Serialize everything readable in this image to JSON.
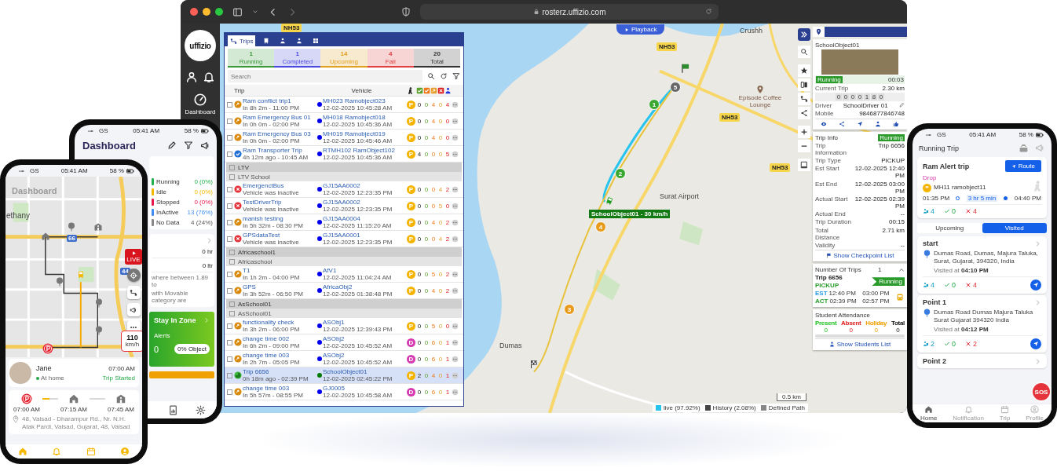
{
  "browser": {
    "url": "rosterz.uffizio.com"
  },
  "app_sidebar": {
    "logo": "uffizio",
    "nav_label": "Dashboard"
  },
  "trips_panel": {
    "tabs": [
      {
        "label": "Trips",
        "kind": "route",
        "selected": true
      },
      {
        "kind": "bus",
        "selected": false
      },
      {
        "kind": "person",
        "selected": false
      },
      {
        "kind": "driver",
        "selected": false
      },
      {
        "kind": "grid",
        "selected": false
      }
    ],
    "summary": [
      {
        "count": "1",
        "label": "Running",
        "color": "#3a9a3a"
      },
      {
        "count": "1",
        "label": "Completed",
        "color": "#4a4ae0"
      },
      {
        "count": "14",
        "label": "Upcoming",
        "color": "#e0a020"
      },
      {
        "count": "4",
        "label": "Fail",
        "color": "#e04040"
      },
      {
        "count": "20",
        "label": "Total",
        "color": "#333333"
      }
    ],
    "search": {
      "placeholder": "Search"
    },
    "columns": [
      {
        "label": "Trip"
      },
      {
        "label": "Vehicle"
      },
      {
        "kind": "walk",
        "color": "#222222"
      },
      {
        "kind": "check",
        "color": "#5aa02c"
      },
      {
        "kind": "check",
        "color": "#f07a1a"
      },
      {
        "kind": "arrow",
        "color": "#e8a030"
      },
      {
        "kind": "cross",
        "color": "#e02020"
      },
      {
        "kind": "person",
        "color": "#2233dd"
      }
    ],
    "rows": [
      {
        "kind": "trip",
        "status": {
          "kind": "upcoming"
        },
        "name": "Ram conflict trip1",
        "detail": "In 8h 2m - 11:00 PM",
        "vehicle": "MH023 Ramobject023",
        "time": "12-02-2025 10:45:28 AM",
        "color": "#0000ee",
        "badge": {
          "text": "P",
          "color": "#f5b400"
        },
        "counts": [
          "0",
          "0",
          "4",
          "0",
          "4"
        ],
        "selected": false
      },
      {
        "kind": "trip",
        "status": {
          "kind": "upcoming"
        },
        "name": "Ram Emergency Bus 01",
        "detail": "In 0h 0m - 02:00 PM",
        "vehicle": "MH018 Ramobject018",
        "time": "12-02-2025 10:45:36 AM",
        "color": "#0000ee",
        "badge": {
          "text": "P",
          "color": "#f5b400"
        },
        "counts": [
          "0",
          "0",
          "4",
          "0",
          "0"
        ],
        "selected": false
      },
      {
        "kind": "trip",
        "status": {
          "kind": "upcoming"
        },
        "name": "Ram Emergency Bus 03",
        "detail": "In 0h 0m - 02:00 PM",
        "vehicle": "MH019 Ramobject019",
        "time": "12-02-2025 10:45:46 AM",
        "color": "#0000ee",
        "badge": {
          "text": "P",
          "color": "#f5b400"
        },
        "counts": [
          "0",
          "0",
          "4",
          "0",
          "0"
        ],
        "selected": false
      },
      {
        "kind": "trip",
        "status": {
          "kind": "completed"
        },
        "name": "Ram Transporter Trip",
        "detail": "4h 12m ago - 10:45 AM",
        "vehicle": "RTMH102 RamObject102",
        "time": "12-02-2025 10:45:36 AM",
        "color": "#0000ee",
        "badge": {
          "text": "P",
          "color": "#f5b400"
        },
        "counts": [
          "4",
          "0",
          "0",
          "0",
          "5"
        ],
        "selected": false
      },
      {
        "kind": "group",
        "label": "LTV",
        "checked": false
      },
      {
        "kind": "subgroup",
        "label": "LTV School",
        "checked": false
      },
      {
        "kind": "trip",
        "status": {
          "kind": "fail"
        },
        "name": "EmergenctBus",
        "detail": "Vehicle was inactive",
        "vehicle": "GJ15AA0002",
        "time": "12-02-2025 12:23:35 PM",
        "color": "#0000ee",
        "badge": {
          "text": "P",
          "color": "#f5b400"
        },
        "counts": [
          "0",
          "0",
          "0",
          "4",
          "2"
        ],
        "selected": false
      },
      {
        "kind": "trip",
        "status": {
          "kind": "fail"
        },
        "name": "TestDriverTrip",
        "detail": "Vehicle was inactive",
        "vehicle": "GJ15AA0002",
        "time": "12-02-2025 12:23:35 PM",
        "color": "#0000ee",
        "badge": {
          "text": "P",
          "color": "#f5b400"
        },
        "counts": [
          "0",
          "0",
          "0",
          "5",
          "0"
        ],
        "selected": false
      },
      {
        "kind": "trip",
        "status": {
          "kind": "upcoming"
        },
        "name": "manish testing",
        "detail": "In 5h 32m - 08:30 PM",
        "vehicle": "GJ15AA0004",
        "time": "12-02-2025 11:15:20 AM",
        "color": "#0000ee",
        "badge": {
          "text": "P",
          "color": "#f5b400"
        },
        "counts": [
          "0",
          "0",
          "4",
          "0",
          "2"
        ],
        "selected": false
      },
      {
        "kind": "trip",
        "status": {
          "kind": "fail"
        },
        "name": "GPSdataTest",
        "detail": "Vehicle was inactive",
        "vehicle": "GJ15AA0001",
        "time": "12-02-2025 12:23:35 PM",
        "color": "#0000ee",
        "badge": {
          "text": "P",
          "color": "#f5b400"
        },
        "counts": [
          "0",
          "0",
          "0",
          "4",
          "2"
        ],
        "selected": false
      },
      {
        "kind": "group",
        "label": "Africaschool1",
        "checked": false
      },
      {
        "kind": "subgroup",
        "label": "Africaschool",
        "checked": false
      },
      {
        "kind": "trip",
        "status": {
          "kind": "upcoming"
        },
        "name": "T1",
        "detail": "In 1h 2m - 04:00 PM",
        "vehicle": "AfV1",
        "time": "12-02-2025 11:04:24 AM",
        "color": "#0000ee",
        "badge": {
          "text": "P",
          "color": "#f5b400"
        },
        "counts": [
          "0",
          "0",
          "5",
          "0",
          "2"
        ],
        "selected": false
      },
      {
        "kind": "trip",
        "status": {
          "kind": "upcoming"
        },
        "name": "GPS",
        "detail": "In 3h 52m - 06:50 PM",
        "vehicle": "AfricaObj2",
        "time": "12-02-2025 01:38:48 PM",
        "color": "#0000ee",
        "badge": {
          "text": "P",
          "color": "#f5b400"
        },
        "counts": [
          "0",
          "0",
          "4",
          "0",
          "2"
        ],
        "selected": false
      },
      {
        "kind": "group",
        "label": "AsSchool01",
        "checked": false
      },
      {
        "kind": "subgroup",
        "label": "AsSchool01",
        "checked": false
      },
      {
        "kind": "trip",
        "status": {
          "kind": "upcoming"
        },
        "name": "functionality check",
        "detail": "In 3h 2m - 06:00 PM",
        "vehicle": "ASObj1",
        "time": "12-02-2025 12:39:43 PM",
        "color": "#0000ee",
        "badge": {
          "text": "P",
          "color": "#f5b400"
        },
        "counts": [
          "0",
          "0",
          "5",
          "0",
          "0"
        ],
        "selected": false
      },
      {
        "kind": "trip",
        "status": {
          "kind": "upcoming"
        },
        "name": "change time 002",
        "detail": "In 6h 2m - 09:00 PM",
        "vehicle": "ASObj2",
        "time": "12-02-2025 10:45:52 AM",
        "color": "#0000ee",
        "badge": {
          "text": "D",
          "color": "#d63ab0"
        },
        "counts": [
          "0",
          "0",
          "6",
          "0",
          "1"
        ],
        "selected": false
      },
      {
        "kind": "trip",
        "status": {
          "kind": "upcoming"
        },
        "name": "change time 003",
        "detail": "In 2h 7m - 05:05 PM",
        "vehicle": "ASObj2",
        "time": "12-02-2025 10:45:52 AM",
        "color": "#0000ee",
        "badge": {
          "text": "D",
          "color": "#d63ab0"
        },
        "counts": [
          "0",
          "0",
          "6",
          "0",
          "1"
        ],
        "selected": false
      },
      {
        "kind": "trip",
        "status": {
          "kind": "running"
        },
        "name": "Trip 6656",
        "detail": "0h 18m ago - 02:39 PM",
        "vehicle": "SchoolObject01",
        "time": "12-02-2025 02:45:22 PM",
        "color": "#007a00",
        "badge": {
          "text": "P",
          "color": "#f5b400"
        },
        "counts": [
          "2",
          "0",
          "4",
          "0",
          "1"
        ],
        "selected": true
      },
      {
        "kind": "trip",
        "status": {
          "kind": "upcoming"
        },
        "name": "change time 003",
        "detail": "In 5h 57m - 08:55 PM",
        "vehicle": "GJ0005",
        "time": "12-02-2025 10:45:58 AM",
        "color": "#0000ee",
        "badge": {
          "text": "D",
          "color": "#d63ab0"
        },
        "counts": [
          "0",
          "0",
          "6",
          "0",
          "1"
        ],
        "selected": false
      }
    ]
  },
  "map": {
    "playback": "Playback",
    "labels": [
      {
        "text": "NH53",
        "kind": "road"
      },
      {
        "text": "NH53",
        "kind": "road"
      },
      {
        "text": "NH53",
        "kind": "road"
      },
      {
        "text": "NH53",
        "kind": "road"
      },
      {
        "text": "Crushh",
        "kind": "place"
      },
      {
        "text": "Episode Coffee Lounge",
        "kind": "poi"
      },
      {
        "text": "Surat Airport",
        "kind": "place"
      },
      {
        "text": "Dumas",
        "kind": "place"
      }
    ],
    "markers": [
      {
        "text": "1",
        "color": "#3aa830"
      },
      {
        "text": "2",
        "color": "#3aa830"
      },
      {
        "text": "3",
        "color": "#e89a1a"
      },
      {
        "text": "4",
        "color": "#e89a1a"
      },
      {
        "text": "5",
        "color": "#666666"
      }
    ],
    "vehicle_label": "SchoolObject01 - 30 km/h",
    "legend": [
      {
        "label": "live (97.92%)",
        "color": "#29c4ee"
      },
      {
        "label": "History (2.08%)",
        "color": "#444444"
      },
      {
        "label": "Defined Path",
        "color": "#888888"
      }
    ],
    "scale": "0.5 km"
  },
  "object_panel": {
    "name": "SchoolObject01",
    "status": "Running",
    "duration": "00:03",
    "current_trip": {
      "label": "Current Trip",
      "value": "2.30 km"
    },
    "odometer": [
      "0",
      "0",
      "0",
      "0",
      "1",
      "8",
      "0"
    ],
    "fields": [
      {
        "label": "Driver",
        "value": "SchoolDriver 01"
      },
      {
        "label": "Mobile",
        "value": "9846877846748"
      }
    ]
  },
  "trip_info": {
    "title": "Trip Info",
    "status": "Running",
    "rows": [
      {
        "label": "Trip Information",
        "value": "Trip 6656"
      },
      {
        "label": "Trip Type",
        "value": "PICKUP"
      },
      {
        "label": "Est Start",
        "value": "12-02-2025 12:40 PM"
      },
      {
        "label": "Est End",
        "value": "12-02-2025 03:00 PM"
      },
      {
        "label": "Actual Start",
        "value": "12-02-2025 02:39 PM"
      },
      {
        "label": "Actual End",
        "value": "--"
      },
      {
        "label": "Trip Duration",
        "value": "00:15"
      },
      {
        "label": "Total Distance",
        "value": "2.71 km"
      },
      {
        "label": "Validity",
        "value": "--"
      }
    ],
    "link": "Show Checkpoint List"
  },
  "number_of_trips": {
    "title": "Number Of Trips",
    "count": "1",
    "trip": "Trip 6656",
    "type": "PICKUP",
    "status": "Running",
    "times": [
      {
        "label": "EST",
        "start": "12:40 PM",
        "end": "03:00 PM",
        "color": "#2a9de0"
      },
      {
        "label": "ACT",
        "start": "02:39 PM",
        "end": "02:57 PM",
        "color": "#2aa02a"
      }
    ]
  },
  "attendance": {
    "title": "Student Attendance",
    "items": [
      {
        "label": "Present",
        "value": "0",
        "color": "#22c422"
      },
      {
        "label": "Absent",
        "value": "0",
        "color": "#e02020"
      },
      {
        "label": "Holiday",
        "value": "0",
        "color": "#f0a000"
      },
      {
        "label": "Total",
        "value": "0",
        "color": "#111111"
      }
    ],
    "link": "Show Students List"
  },
  "back_phone": {
    "status": {
      "carrier": "GS",
      "time": "05:41 AM",
      "battery": "58 %"
    },
    "title": "Dashboard",
    "legend": [
      {
        "label": "Running",
        "value": "0 (0%)",
        "color": "#22b14c"
      },
      {
        "label": "Idle",
        "value": "0 (0%)",
        "color": "#f5b800"
      },
      {
        "label": "Stopped",
        "value": "0 (0%)",
        "color": "#e8194a"
      },
      {
        "label": "InActive",
        "value": "13 (76%)",
        "color": "#3d8ef0"
      },
      {
        "label": "No Data",
        "value": "4 (24%)",
        "color": "#888888"
      }
    ],
    "stats": [
      "0 hr",
      "0 ltr"
    ],
    "note_lines": [
      "where between 1.89 to",
      "with Movable category are"
    ],
    "zone": {
      "title": "Stay In Zone",
      "alerts_label": "Alerts",
      "alerts": "0",
      "object_badge": "0% Object"
    }
  },
  "front_phone": {
    "status": {
      "carrier": "GS",
      "time": "05:41 AM",
      "battery": "58 %"
    },
    "map_labels": [
      {
        "text": "Dashboard",
        "kind": "ghost"
      },
      {
        "text": "ethany",
        "kind": "place"
      },
      {
        "text": "66",
        "kind": "shield"
      },
      {
        "text": "44",
        "kind": "shield"
      }
    ],
    "live_button": "LIVE",
    "speed": {
      "value": "110",
      "unit": "km/h"
    },
    "rider": {
      "name": "Jane",
      "status": "At home",
      "time": "07:00 AM",
      "trip_status": "Trip Started"
    },
    "stops": [
      {
        "time": "07:00 AM",
        "kind": "parking"
      },
      {
        "time": "07:15 AM",
        "kind": "home"
      },
      {
        "time": "07:45 AM",
        "kind": "school"
      }
    ],
    "segments": [
      {
        "level": 0.45
      },
      {
        "level": 0
      }
    ],
    "address": "48, Valsad - Dharampur Rd., Nr. N.H. Atak Pardi, Valsad, Gujarat, 48, Valsad"
  },
  "right_phone": {
    "status": {
      "carrier": "GS",
      "time": "05:41 AM",
      "battery": "58 %"
    },
    "title": "Running Trip",
    "trip": {
      "name": "Ram Alert trip",
      "route_button": "Route",
      "type": "Drop",
      "vehicle": "MH11 ramobject11",
      "start": "01:35 PM",
      "duration": "3 hr 5 min",
      "end": "04:40 PM",
      "counts": [
        "4",
        "0",
        "4"
      ]
    },
    "tabs": [
      {
        "label": "Upcoming",
        "selected": false
      },
      {
        "label": "Visited",
        "selected": true
      }
    ],
    "stops": [
      {
        "name": "start",
        "address": "Dumas Road, Dumas, Majura Taluka, Surat, Gujarat, 394320, India",
        "visited": "Visited at **04:10 PM**",
        "counts": [
          "4",
          "0",
          "4"
        ]
      },
      {
        "name": "Point 1",
        "address": "Dumas Road Dumas Majura Taluka Surat Gujarat 394320 India",
        "visited": "Visited at **04:12 PM**",
        "counts": [
          "2",
          "0",
          "2"
        ]
      },
      {
        "name": "Point 2"
      }
    ],
    "sos": "SOS",
    "nav": [
      {
        "label": "Home",
        "selected": true
      },
      {
        "label": "Notification",
        "selected": false
      },
      {
        "label": "Trip",
        "selected": false
      },
      {
        "label": "Profile",
        "selected": false
      }
    ]
  }
}
